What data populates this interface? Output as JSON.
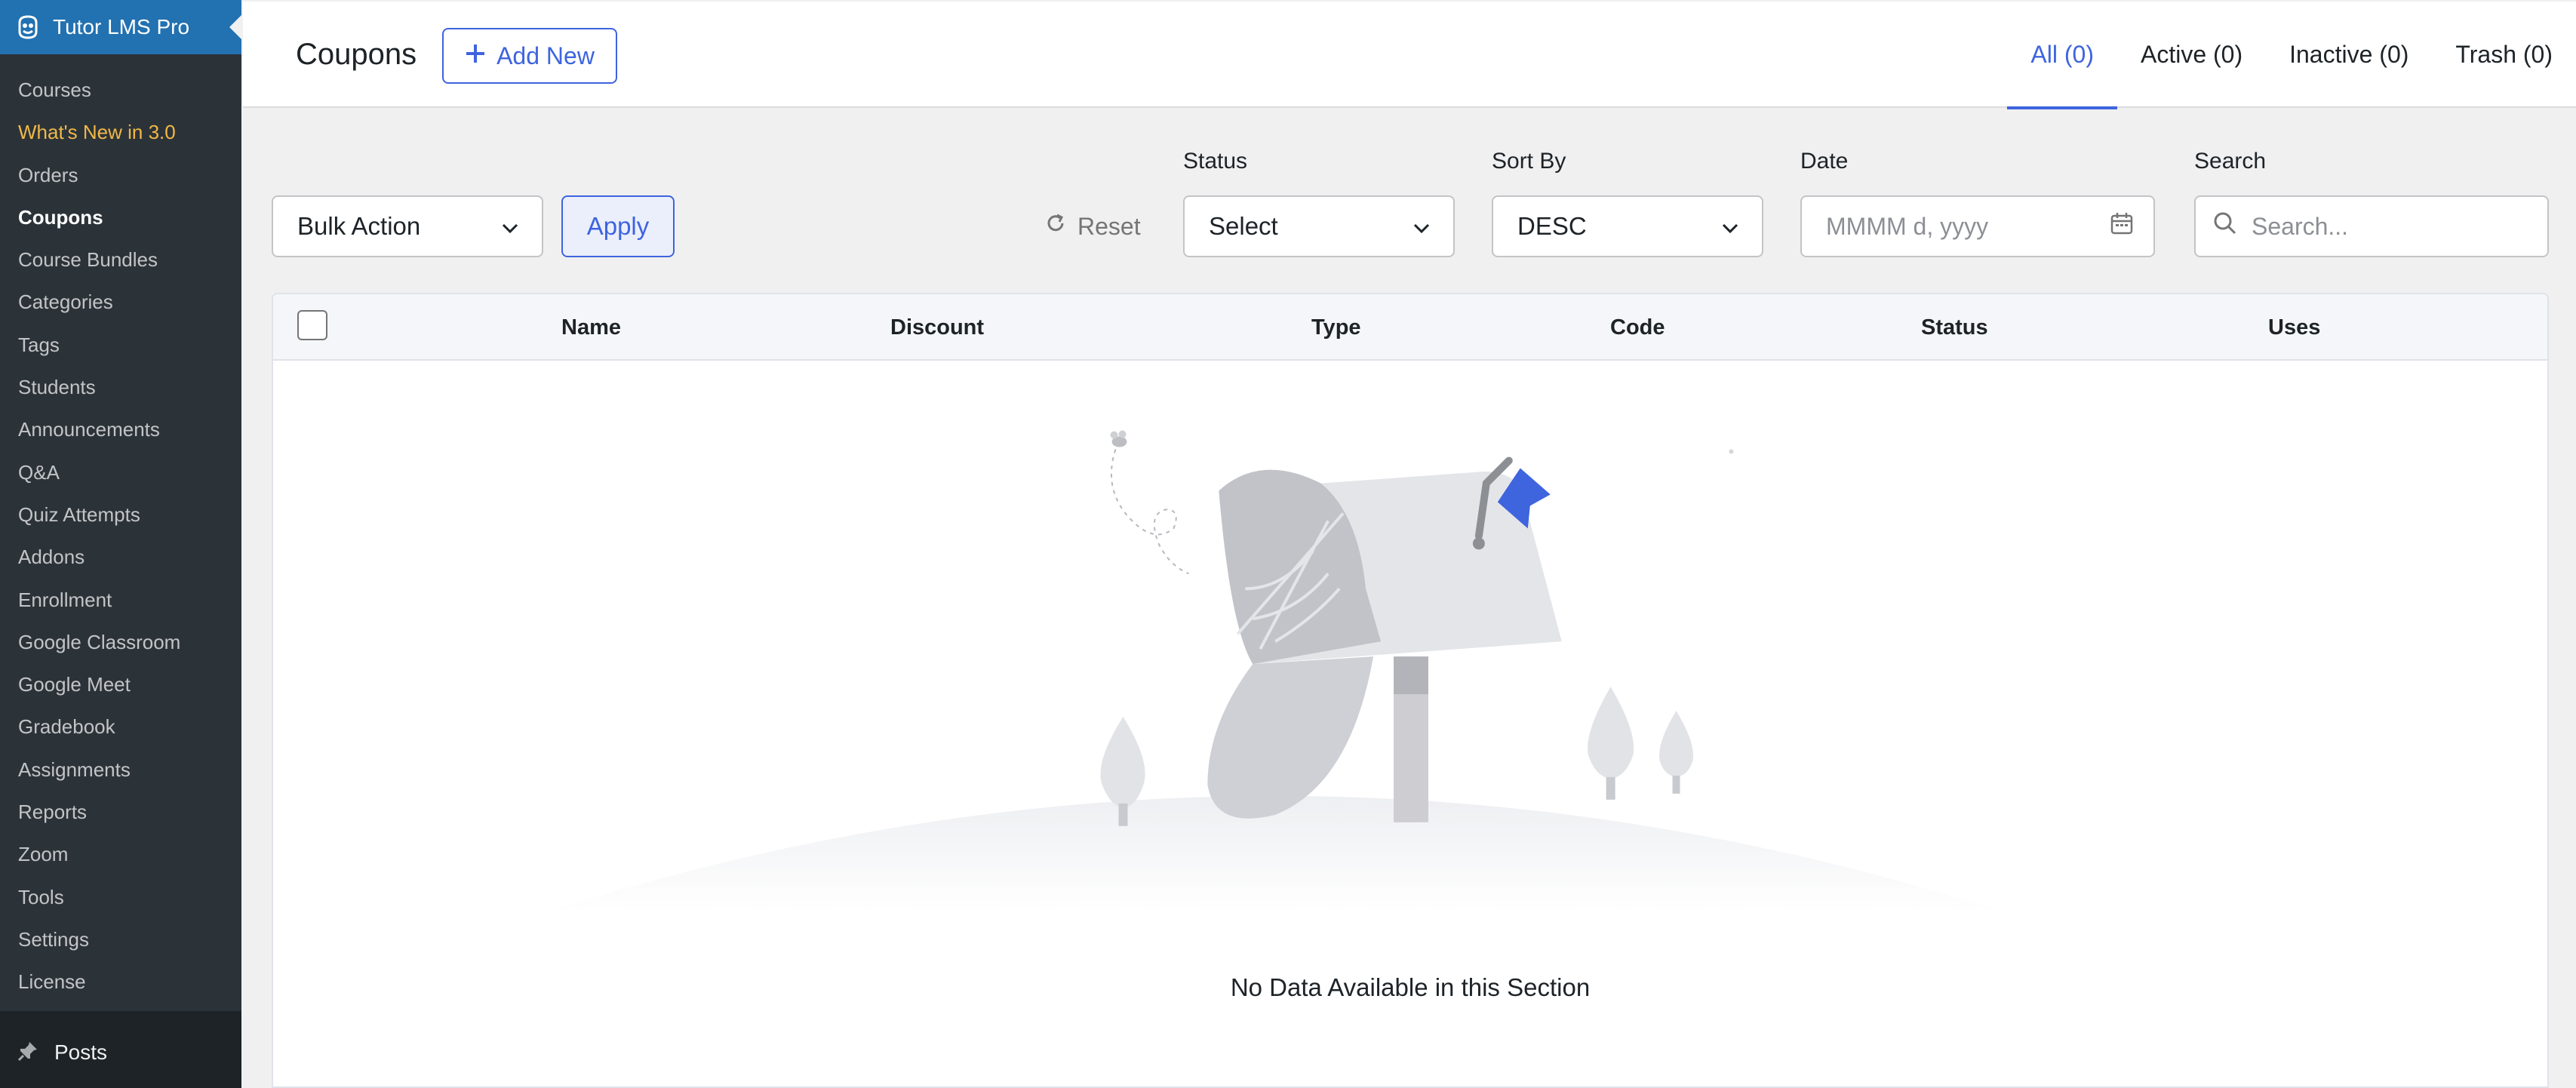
{
  "sidebar": {
    "brand": "Tutor LMS Pro",
    "items": [
      {
        "label": "Courses"
      },
      {
        "label": "What's New in 3.0"
      },
      {
        "label": "Orders"
      },
      {
        "label": "Coupons"
      },
      {
        "label": "Course Bundles"
      },
      {
        "label": "Categories"
      },
      {
        "label": "Tags"
      },
      {
        "label": "Students"
      },
      {
        "label": "Announcements"
      },
      {
        "label": "Q&A"
      },
      {
        "label": "Quiz Attempts"
      },
      {
        "label": "Addons"
      },
      {
        "label": "Enrollment"
      },
      {
        "label": "Google Classroom"
      },
      {
        "label": "Google Meet"
      },
      {
        "label": "Gradebook"
      },
      {
        "label": "Assignments"
      },
      {
        "label": "Reports"
      },
      {
        "label": "Zoom"
      },
      {
        "label": "Tools"
      },
      {
        "label": "Settings"
      },
      {
        "label": "License"
      }
    ],
    "posts_label": "Posts"
  },
  "header": {
    "title": "Coupons",
    "add_new": "Add New",
    "tabs": [
      {
        "label": "All (0)"
      },
      {
        "label": "Active (0)"
      },
      {
        "label": "Inactive (0)"
      },
      {
        "label": "Trash (0)"
      }
    ]
  },
  "filters": {
    "bulk_action": "Bulk Action",
    "apply": "Apply",
    "reset": "Reset",
    "status_label": "Status",
    "status_value": "Select",
    "sort_label": "Sort By",
    "sort_value": "DESC",
    "date_label": "Date",
    "date_placeholder": "MMMM d, yyyy",
    "search_label": "Search",
    "search_placeholder": "Search..."
  },
  "table": {
    "columns": [
      "Name",
      "Discount",
      "Type",
      "Code",
      "Status",
      "Uses"
    ],
    "empty_message": "No Data Available in this Section"
  },
  "colors": {
    "accent": "#3e64de",
    "sidebar_bg": "#1d2327",
    "submenu_bg": "#2c3338",
    "wp_blue": "#2271b1",
    "new_highlight": "#f0b849"
  }
}
